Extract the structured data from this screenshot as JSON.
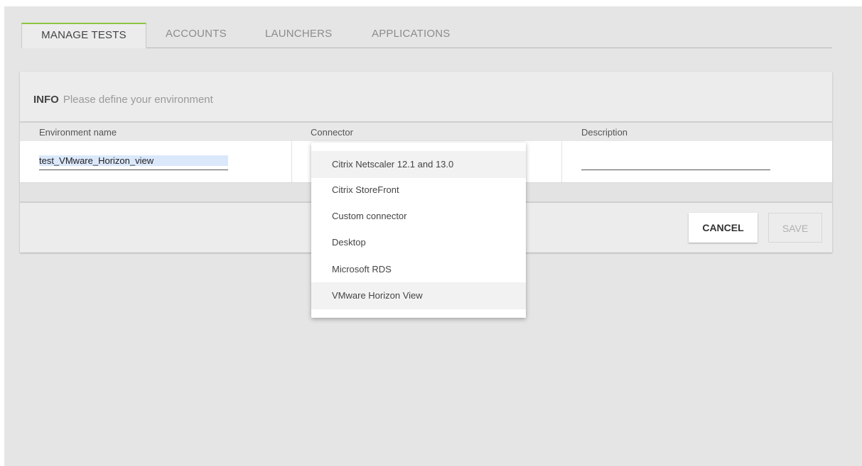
{
  "tabs": [
    {
      "label": "MANAGE TESTS",
      "active": true
    },
    {
      "label": "ACCOUNTS",
      "active": false
    },
    {
      "label": "LAUNCHERS",
      "active": false
    },
    {
      "label": "APPLICATIONS",
      "active": false
    }
  ],
  "info": {
    "title": "INFO",
    "text": "Please define your environment"
  },
  "table": {
    "headers": [
      "Environment name",
      "Connector",
      "Description"
    ],
    "row": {
      "environment_name": "test_VMware_Horizon_view",
      "description": ""
    }
  },
  "connector_dropdown": {
    "options": [
      "Citrix Netscaler 12.1 and 13.0",
      "Citrix StoreFront",
      "Custom connector",
      "Desktop",
      "Microsoft RDS",
      "VMware Horizon View"
    ],
    "highlighted": [
      "Citrix Netscaler 12.1 and 13.0",
      "VMware Horizon View"
    ]
  },
  "buttons": {
    "cancel": "CANCEL",
    "save": "SAVE"
  },
  "colors": {
    "active_tab_accent": "#8dc63f",
    "background": "#e5e5e5",
    "card": "#ececec"
  }
}
